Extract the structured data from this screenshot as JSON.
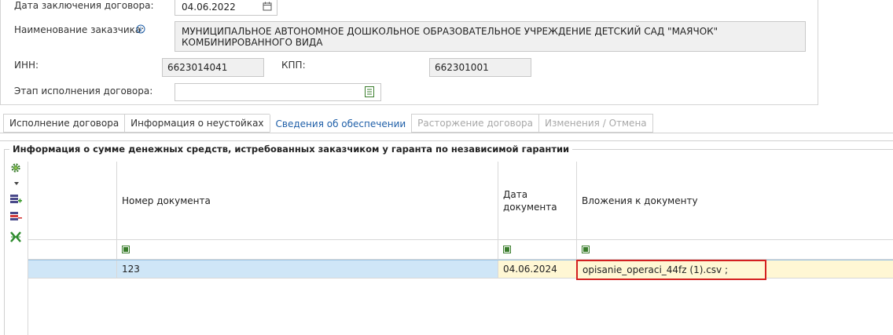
{
  "form": {
    "contract_date_label": "Дата заключения договора:",
    "contract_date_value": "04.06.2022",
    "customer_name_label": "Наименование заказчика:",
    "customer_name_line1": "МУНИЦИПАЛЬНОЕ АВТОНОМНОЕ ДОШКОЛЬНОЕ ОБРАЗОВАТЕЛЬНОЕ УЧРЕЖДЕНИЕ  ДЕТСКИЙ САД \"МАЯЧОК\"",
    "customer_name_line2": "КОМБИНИРОВАННОГО ВИДА",
    "inn_label": "ИНН:",
    "inn_value": "6623014041",
    "kpp_label": "КПП:",
    "kpp_value": "662301001",
    "stage_label": "Этап исполнения договора:",
    "stage_value": ""
  },
  "tabs": [
    {
      "label": "Исполнение договора",
      "state": "normal"
    },
    {
      "label": "Информация о неустойках",
      "state": "normal"
    },
    {
      "label": "Сведения об обеспечении",
      "state": "active"
    },
    {
      "label": "Расторжение договора",
      "state": "disabled"
    },
    {
      "label": "Изменения / Отмена",
      "state": "disabled"
    }
  ],
  "group": {
    "title": "Информация о сумме денежных средств, истребованных заказчиком у гаранта по независимой гарантии"
  },
  "toolbar": {
    "icons": [
      "settings-gear-icon",
      "dropdown-arrow-icon",
      "add-row-icon",
      "delete-row-icon",
      "excel-export-icon"
    ]
  },
  "grid": {
    "columns": [
      {
        "label": ""
      },
      {
        "label": "Номер документа"
      },
      {
        "label_line1": "Дата",
        "label_line2": "документа"
      },
      {
        "label": "Вложения к документу"
      }
    ],
    "rows": [
      {
        "number": "123",
        "date": "04.06.2024",
        "attachment": "opisanie_operaci_44fz (1).csv ;"
      }
    ]
  },
  "colors": {
    "active_tab": "#1f5fa8",
    "selected_row": "#cfe6f7",
    "highlight_cell": "#fff7d4",
    "red_outline": "#d42020",
    "green_icon": "#3a7d2c"
  }
}
